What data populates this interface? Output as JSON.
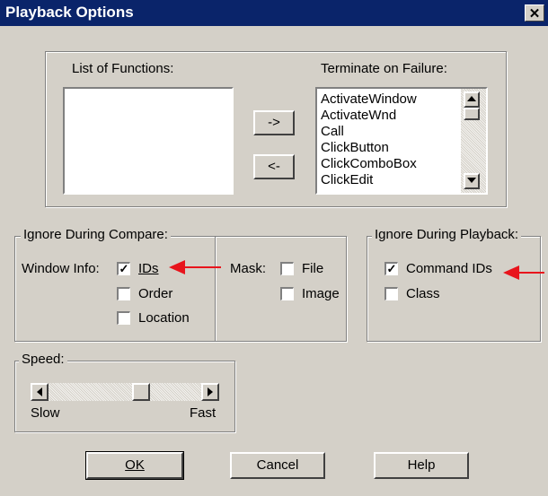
{
  "window": {
    "title": "Playback Options",
    "close_glyph": "✕"
  },
  "functions": {
    "list_label": "List of Functions:",
    "terminate_label": "Terminate on Failure:",
    "add_button": "->",
    "remove_button": "<-",
    "terminate_items": [
      "ActivateWindow",
      "ActivateWnd",
      "Call",
      "ClickButton",
      "ClickComboBox",
      "ClickEdit"
    ]
  },
  "compare": {
    "title": "Ignore During Compare:",
    "window_info_label": "Window Info:",
    "ids": {
      "label": "IDs",
      "checked": true
    },
    "order": {
      "label": "Order",
      "checked": false
    },
    "location": {
      "label": "Location",
      "checked": false
    },
    "mask_label": "Mask:",
    "file": {
      "label": "File",
      "checked": false
    },
    "image": {
      "label": "Image",
      "checked": false
    }
  },
  "playback": {
    "title": "Ignore During Playback:",
    "command_ids": {
      "label": "Command IDs",
      "checked": true
    },
    "class": {
      "label": "Class",
      "checked": false
    }
  },
  "speed": {
    "title": "Speed:",
    "slow_label": "Slow",
    "fast_label": "Fast",
    "level": 0.62
  },
  "buttons": {
    "ok": "OK",
    "cancel": "Cancel",
    "help": "Help"
  },
  "annotations": {
    "arrow_color": "#e8141c"
  },
  "icons": {
    "scroll_up": "up-arrow-icon",
    "scroll_down": "down-arrow-icon",
    "scroll_left": "left-arrow-icon",
    "scroll_right": "right-arrow-icon"
  }
}
